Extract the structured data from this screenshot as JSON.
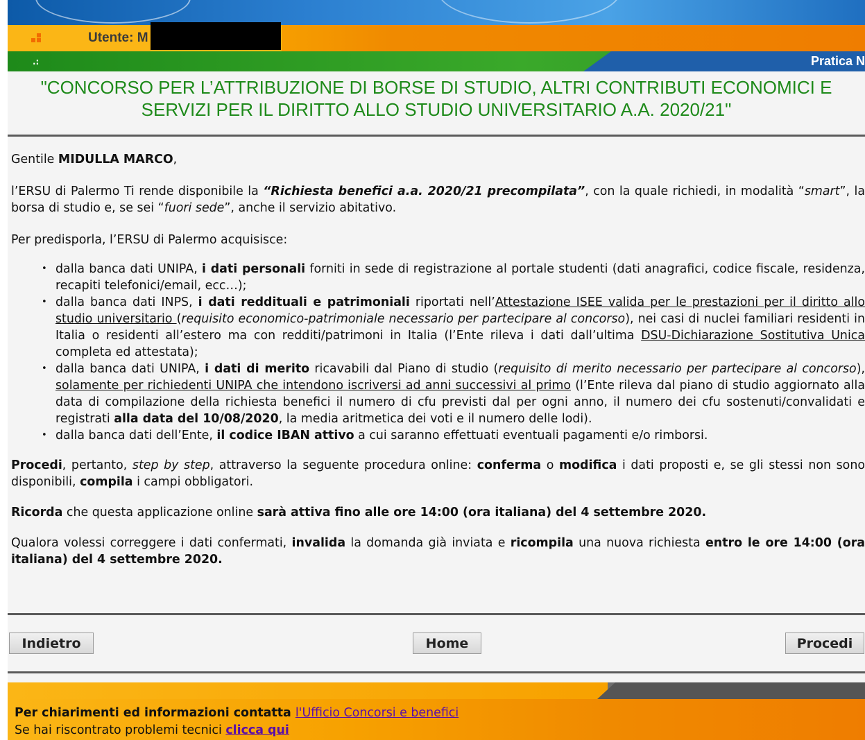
{
  "header": {
    "user_label": "Utente: M",
    "pratica_label": "Pratica N"
  },
  "title": {
    "line1": "\"CONCORSO PER L’ATTRIBUZIONE DI BORSE DI STUDIO, ALTRI CONTRIBUTI ECONOMICI E",
    "line2": "SERVIZI PER IL DIRITTO ALLO STUDIO UNIVERSITARIO A.A. 2020/21\""
  },
  "body": {
    "greeting_prefix": "Gentile ",
    "greeting_name": "MIDULLA MARCO",
    "greeting_suffix": ",",
    "intro": {
      "a": "l’ERSU di Palermo Ti rende disponibile la ",
      "b": "“Richiesta benefici a.a. 2020/21 precompilata”",
      "c": ", con la quale richiedi, in modalità “",
      "d": "smart",
      "e": "”, la borsa di studio e, se sei “",
      "f": "fuori sede",
      "g": "”, anche il servizio abitativo."
    },
    "acquire_intro": "Per predisporla, l’ERSU di Palermo acquisisce:",
    "bullets": {
      "b1": {
        "a": "dalla banca dati UNIPA, ",
        "b": "i dati personali",
        "c": " forniti in sede di registrazione al portale studenti (dati anagrafici, codice fiscale, residenza, recapiti telefonici/email, ecc…);"
      },
      "b2": {
        "a": "dalla banca dati INPS, ",
        "b": "i dati reddituali e patrimoniali",
        "c": " riportati nell’",
        "d": "Attestazione ISEE valida per le prestazioni per il diritto allo studio universitario ",
        "e": "(",
        "f": "requisito economico-patrimoniale necessario per partecipare al concorso",
        "g": "), nei casi di nuclei familiari residenti in Italia o residenti all’estero ma con redditi/patrimoni in Italia (l’Ente rileva i dati dall’ultima ",
        "h": "DSU-Dichiarazione Sostitutiva Unica",
        "i": " completa ed attestata);"
      },
      "b3": {
        "a": "dalla banca dati UNIPA, ",
        "b": "i dati di merito",
        "c": " ricavabili dal Piano di studio (",
        "d": "requisito di merito necessario per partecipare al concorso",
        "e": "), ",
        "f": "solamente per richiedenti UNIPA che intendono iscriversi ad anni successivi al primo",
        "g": " (l’Ente rileva dal piano di studio aggiornato alla data di compilazione della richiesta benefici il numero di cfu previsti dal per ogni anno, il numero dei cfu sostenuti/convalidati e registrati ",
        "h": "alla data del 10/08/2020",
        "i": ", la media aritmetica dei voti e il numero delle lodi)."
      },
      "b4": {
        "a": "dalla banca dati dell’Ente, ",
        "b": "il codice IBAN attivo",
        "c": " a cui saranno effettuati eventuali pagamenti e/o rimborsi."
      }
    },
    "procedi_par": {
      "a": "Procedi",
      "b": ", pertanto, ",
      "c": "step by step",
      "d": ", attraverso la seguente procedura online: ",
      "e": "conferma",
      "f": " o ",
      "g": "modifica",
      "h": " i dati proposti e, se gli stessi non sono disponibili, ",
      "i": "compila",
      "j": " i campi obbligatori."
    },
    "ricorda_par": {
      "a": "Ricorda",
      "b": " che questa applicazione online ",
      "c": "sarà attiva fino alle ore 14:00 (ora italiana) del 4 settembre 2020."
    },
    "qualora_par": {
      "a": "Qualora volessi correggere i dati confermati, ",
      "b": "invalida",
      "c": " la domanda già inviata e ",
      "d": "ricompila",
      "e": "  una nuova richiesta ",
      "f": "entro le ore 14:00 (ora italiana) del 4 settembre 2020."
    }
  },
  "buttons": {
    "back": "Indietro",
    "home": "Home",
    "next": "Procedi"
  },
  "footer": {
    "line1_text": "Per chiarimenti ed informazioni contatta ",
    "line1_link": "l'Ufficio Concorsi e benefici",
    "line2_text": "Se hai riscontrato problemi tecnici ",
    "line2_link": "clicca qui"
  }
}
